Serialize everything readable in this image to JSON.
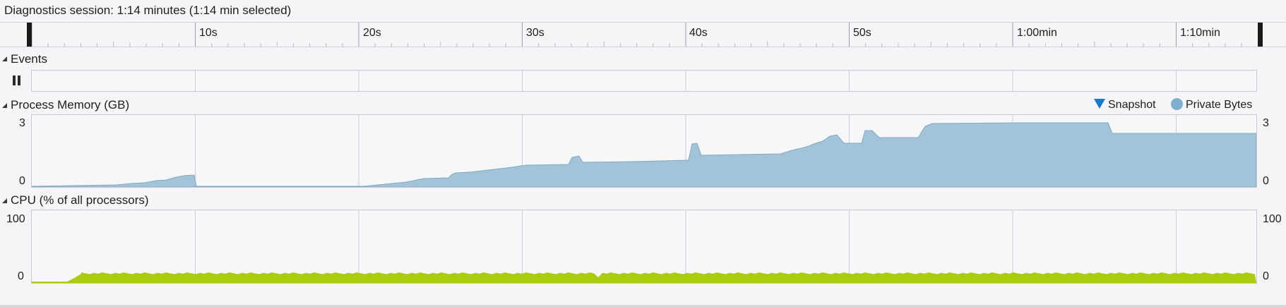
{
  "session": {
    "title": "Diagnostics session: 1:14 minutes (1:14 min selected)"
  },
  "ruler": {
    "labels": [
      "10s",
      "20s",
      "30s",
      "40s",
      "50s",
      "1:00min",
      "1:10min"
    ]
  },
  "events": {
    "title": "Events",
    "pause_icon": "pause-icon"
  },
  "memory": {
    "title": "Process Memory (GB)",
    "legend": {
      "snapshot_label": "Snapshot",
      "private_bytes_label": "Private Bytes"
    },
    "y_max_label": "3",
    "y_min_label": "0",
    "colors": {
      "fill": "#a3c4d8",
      "stroke": "#7fa9c2",
      "snapshot": "#1a78c8",
      "private": "#7fb0cf"
    }
  },
  "cpu": {
    "title": "CPU (% of all processors)",
    "y_max_label": "100",
    "y_min_label": "0",
    "colors": {
      "fill": "#a9cc0e"
    }
  },
  "colors": {
    "grid": "#c9ccd8",
    "background": "#f5f5f7"
  }
}
